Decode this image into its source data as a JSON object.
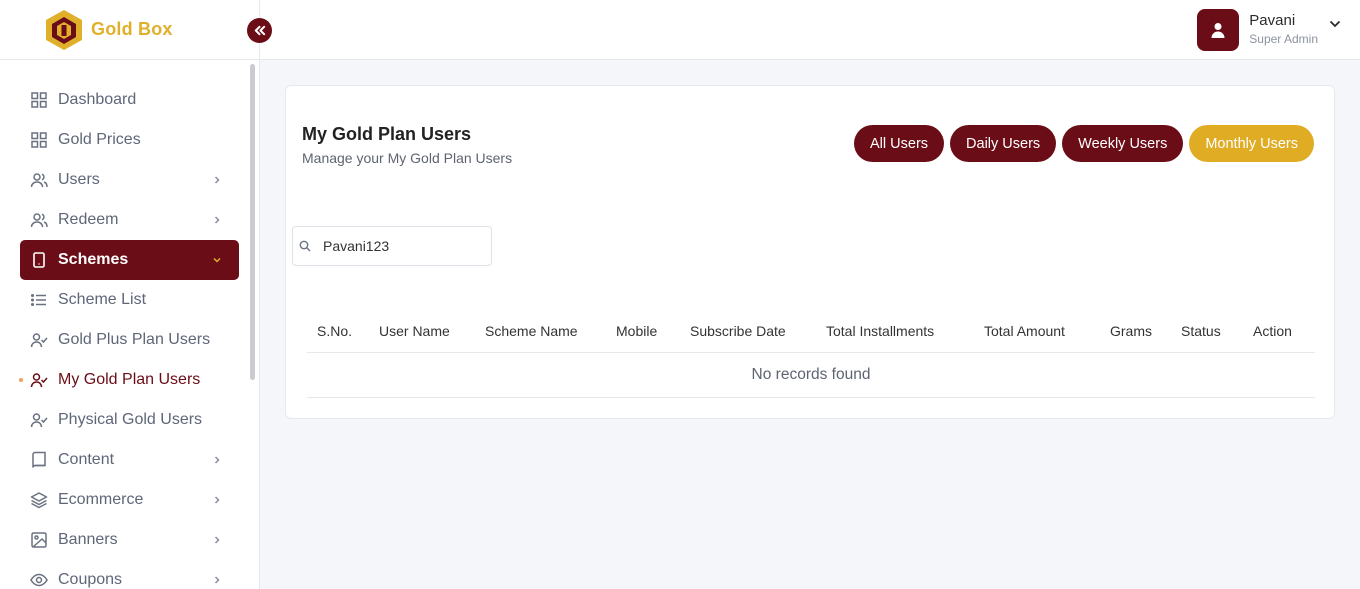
{
  "brand": {
    "name": "Gold Box",
    "accent": "#e0b02a",
    "primary": "#6b0d17"
  },
  "sidebar": {
    "items": [
      {
        "label": "Dashboard",
        "icon": "grid-icon",
        "has_chevron": false
      },
      {
        "label": "Gold Prices",
        "icon": "grid-icon",
        "has_chevron": false
      },
      {
        "label": "Users",
        "icon": "users-icon",
        "has_chevron": true
      },
      {
        "label": "Redeem",
        "icon": "users-icon",
        "has_chevron": true
      },
      {
        "label": "Schemes",
        "icon": "tablet-icon",
        "has_chevron": true,
        "state": "expanded"
      },
      {
        "label": "Scheme List",
        "icon": "list-icon",
        "has_chevron": false
      },
      {
        "label": "Gold Plus Plan Users",
        "icon": "user-check-icon",
        "has_chevron": false
      },
      {
        "label": "My Gold Plan Users",
        "icon": "user-check-icon",
        "has_chevron": false,
        "state": "current"
      },
      {
        "label": "Physical Gold Users",
        "icon": "user-check-icon",
        "has_chevron": false
      },
      {
        "label": "Content",
        "icon": "book-icon",
        "has_chevron": true
      },
      {
        "label": "Ecommerce",
        "icon": "layers-icon",
        "has_chevron": true
      },
      {
        "label": "Banners",
        "icon": "image-icon",
        "has_chevron": true
      },
      {
        "label": "Coupons",
        "icon": "eye-icon",
        "has_chevron": true
      }
    ]
  },
  "header": {
    "user_name": "Pavani",
    "user_role": "Super Admin"
  },
  "main": {
    "title": "My Gold Plan Users",
    "subtitle": "Manage your My Gold Plan Users",
    "filters": [
      "All Users",
      "Daily Users",
      "Weekly Users",
      "Monthly Users"
    ],
    "active_filter": "Monthly Users",
    "search_value": "Pavani123",
    "columns": [
      "S.No.",
      "User Name",
      "Scheme Name",
      "Mobile",
      "Subscribe Date",
      "Total Installments",
      "Total Amount",
      "Grams",
      "Status",
      "Action"
    ],
    "empty_text": "No records found"
  }
}
